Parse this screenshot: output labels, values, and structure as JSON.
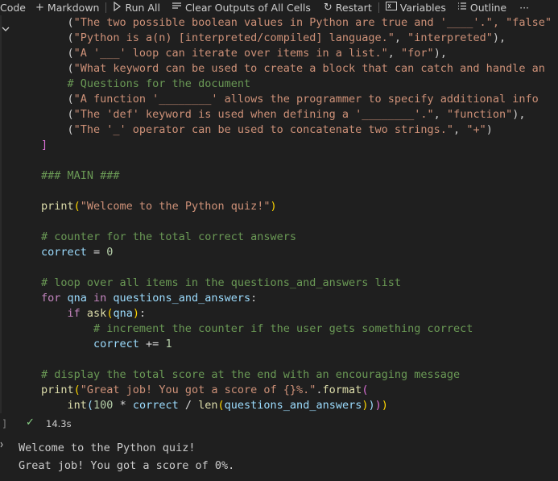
{
  "toolbar": {
    "code": "Code",
    "markdown": "Markdown",
    "run_all": "Run All",
    "clear_outputs": "Clear Outputs of All Cells",
    "restart": "Restart",
    "variables": "Variables",
    "outline": "Outline",
    "more": "···"
  },
  "code_lines": [
    [
      {
        "t": "    (",
        "c": "plain"
      },
      {
        "t": "\"The two possible boolean values in Python are true and '____'.\", \"false\"",
        "c": "s"
      }
    ],
    [
      {
        "t": "    (",
        "c": "plain"
      },
      {
        "t": "\"Python is a(n) [interpreted/compiled] language.\"",
        "c": "s"
      },
      {
        "t": ", ",
        "c": "plain"
      },
      {
        "t": "\"interpreted\"",
        "c": "s"
      },
      {
        "t": "),",
        "c": "plain"
      }
    ],
    [
      {
        "t": "    (",
        "c": "plain"
      },
      {
        "t": "\"A '___' loop can iterate over items in a list.\"",
        "c": "s"
      },
      {
        "t": ", ",
        "c": "plain"
      },
      {
        "t": "\"for\"",
        "c": "s"
      },
      {
        "t": "),",
        "c": "plain"
      }
    ],
    [
      {
        "t": "    (",
        "c": "plain"
      },
      {
        "t": "\"What keyword can be used to create a block that can catch and handle an",
        "c": "s"
      }
    ],
    [
      {
        "t": "    # Questions for the document",
        "c": "c"
      }
    ],
    [
      {
        "t": "    (",
        "c": "plain"
      },
      {
        "t": "\"A function '________' allows the programmer to specify additional info",
        "c": "s"
      }
    ],
    [
      {
        "t": "    (",
        "c": "plain"
      },
      {
        "t": "\"The 'def' keyword is used when defining a '________'.\"",
        "c": "s"
      },
      {
        "t": ", ",
        "c": "plain"
      },
      {
        "t": "\"function\"",
        "c": "s"
      },
      {
        "t": "),",
        "c": "plain"
      }
    ],
    [
      {
        "t": "    (",
        "c": "plain"
      },
      {
        "t": "\"The '_' operator can be used to concatenate two strings.\"",
        "c": "s"
      },
      {
        "t": ", ",
        "c": "plain"
      },
      {
        "t": "\"+\"",
        "c": "s"
      },
      {
        "t": ")",
        "c": "plain"
      }
    ],
    [
      {
        "t": "]",
        "c": "bb"
      }
    ],
    [],
    [
      {
        "t": "### MAIN ###",
        "c": "c"
      }
    ],
    [],
    [
      {
        "t": "print",
        "c": "f"
      },
      {
        "t": "(",
        "c": "bp"
      },
      {
        "t": "\"Welcome to the Python quiz!\"",
        "c": "s"
      },
      {
        "t": ")",
        "c": "bp"
      }
    ],
    [],
    [
      {
        "t": "# counter for the total correct answers",
        "c": "c"
      }
    ],
    [
      {
        "t": "correct",
        "c": "v"
      },
      {
        "t": " = ",
        "c": "op"
      },
      {
        "t": "0",
        "c": "n"
      }
    ],
    [],
    [
      {
        "t": "# loop over all items in the questions_and_answers list",
        "c": "c"
      }
    ],
    [
      {
        "t": "for",
        "c": "k"
      },
      {
        "t": " qna ",
        "c": "v"
      },
      {
        "t": "in",
        "c": "k"
      },
      {
        "t": " questions_and_answers",
        "c": "v"
      },
      {
        "t": ":",
        "c": "plain"
      }
    ],
    [
      {
        "t": "    ",
        "c": "plain"
      },
      {
        "t": "if",
        "c": "k"
      },
      {
        "t": " ",
        "c": "plain"
      },
      {
        "t": "ask",
        "c": "f"
      },
      {
        "t": "(",
        "c": "bp"
      },
      {
        "t": "qna",
        "c": "v"
      },
      {
        "t": ")",
        "c": "bp"
      },
      {
        "t": ":",
        "c": "plain"
      }
    ],
    [
      {
        "t": "        # increment the counter if the user gets something correct",
        "c": "c"
      }
    ],
    [
      {
        "t": "        correct",
        "c": "v"
      },
      {
        "t": " += ",
        "c": "op"
      },
      {
        "t": "1",
        "c": "n"
      }
    ],
    [],
    [
      {
        "t": "# display the total score at the end with an encouraging message",
        "c": "c"
      }
    ],
    [
      {
        "t": "print",
        "c": "f"
      },
      {
        "t": "(",
        "c": "bp"
      },
      {
        "t": "\"Great job! You got a score of {}%.\"",
        "c": "s"
      },
      {
        "t": ".",
        "c": "plain"
      },
      {
        "t": "format",
        "c": "f"
      },
      {
        "t": "(",
        "c": "bb"
      }
    ],
    [
      {
        "t": "    ",
        "c": "plain"
      },
      {
        "t": "int",
        "c": "f"
      },
      {
        "t": "(",
        "c": "v"
      },
      {
        "t": "100",
        "c": "n"
      },
      {
        "t": " * ",
        "c": "op"
      },
      {
        "t": "correct",
        "c": "v"
      },
      {
        "t": " / ",
        "c": "op"
      },
      {
        "t": "len",
        "c": "f"
      },
      {
        "t": "(",
        "c": "bp"
      },
      {
        "t": "questions_and_answers",
        "c": "v"
      },
      {
        "t": ")",
        "c": "bp"
      },
      {
        "t": ")",
        "c": "v"
      },
      {
        "t": ")",
        "c": "bb"
      },
      {
        "t": ")",
        "c": "bp"
      }
    ]
  ],
  "status": {
    "bracket": "]",
    "check_icon": "check-icon",
    "time": "14.3s"
  },
  "output": {
    "lines": [
      "Welcome to the Python quiz!",
      "Great job! You got a score of 0%."
    ]
  }
}
